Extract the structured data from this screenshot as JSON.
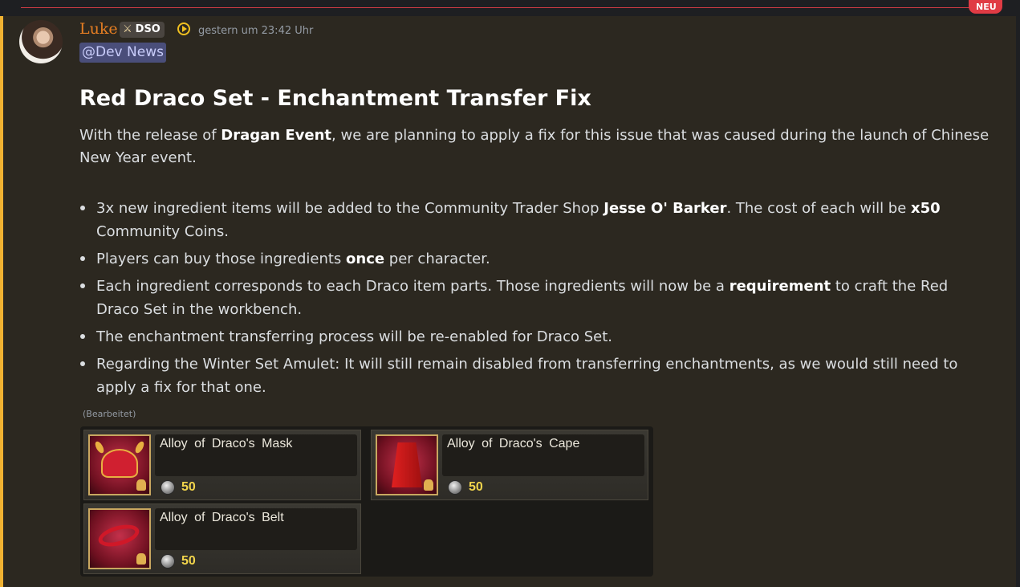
{
  "divider": {
    "badge": "NEU",
    "color": "#c93b43"
  },
  "message": {
    "username": "Luke",
    "username_color": "#e67e22",
    "role_tag": "DSO",
    "timestamp": "gestern um 23:42 Uhr",
    "mention": "@Dev News",
    "headline": "Red Draco Set - Enchantment Transfer Fix",
    "intro": {
      "p1": "With the release of ",
      "b1": "Dragan Event",
      "p2": ", we are planning to apply a fix for this issue that was caused during the launch of Chinese New Year event."
    },
    "bullets": [
      {
        "t1": "3x new ingredient items will be added to the Community Trader Shop ",
        "b1": "Jesse O' Barker",
        "t2": ". The cost of each will be ",
        "b2": "x50",
        "t3": " Community Coins."
      },
      {
        "t1": "Players can buy those ingredients ",
        "b1": "once",
        "t2": " per character."
      },
      {
        "t1": "Each ingredient corresponds to each Draco item parts. Those ingredients will now be a ",
        "b1": "requirement",
        "t2": " to craft the Red Draco Set in the workbench."
      },
      {
        "t1": "The enchantment transferring process will be re-enabled for Draco Set."
      },
      {
        "t1": "Regarding the Winter Set Amulet: It will still remain disabled from transferring enchantments, as we would still need to apply a fix for that one."
      }
    ],
    "edited": "(Bearbeitet)"
  },
  "shop": {
    "items": [
      {
        "name": "Alloy of Draco's Mask",
        "price": "50",
        "icon": "helmet-icon"
      },
      {
        "name": "Alloy of Draco's Cape",
        "price": "50",
        "icon": "cape-icon"
      },
      {
        "name": "Alloy of Draco's Belt",
        "price": "50",
        "icon": "belt-icon"
      }
    ],
    "coin_icon": "silver-coin-icon",
    "price_color": "#f2d54c"
  }
}
